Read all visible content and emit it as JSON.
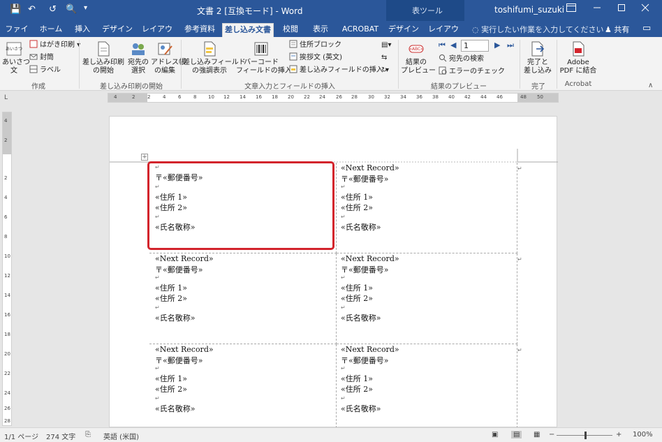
{
  "titlebar": {
    "doc_title": "文書 2 [互換モード] - Word",
    "context_tool": "表ツール",
    "user": "toshifumi_suzuki",
    "quick_access": {
      "save": "💾",
      "undo": "↶",
      "redo": "↺",
      "preview": "🔍",
      "customize": "▾"
    }
  },
  "tabs": [
    {
      "label": "ファイル"
    },
    {
      "label": "ホーム"
    },
    {
      "label": "挿入"
    },
    {
      "label": "デザイン"
    },
    {
      "label": "レイアウト"
    },
    {
      "label": "参考資料"
    },
    {
      "label": "差し込み文書"
    },
    {
      "label": "校閲"
    },
    {
      "label": "表示"
    },
    {
      "label": "ACROBAT"
    },
    {
      "label": "デザイン"
    },
    {
      "label": "レイアウト"
    }
  ],
  "tell_me": "実行したい作業を入力してください",
  "share": "共有",
  "ribbon": {
    "create": {
      "greeting_btn": "あいさつ\n文",
      "postcard": "はがき印刷",
      "envelope": "封筒",
      "labels": "ラベル",
      "group": "作成"
    },
    "start_merge": {
      "start_btn": "差し込み印刷\nの開始",
      "select_btn": "宛先の\n選択",
      "edit_btn": "アドレス帳\nの編集",
      "group": "差し込み印刷の開始"
    },
    "write_insert": {
      "highlight_btn": "差し込みフィールド\nの強調表示",
      "barcode_btn": "バーコード\nフィールドの挿入",
      "address_block": "住所ブロック",
      "greeting_line": "挨拶文 (英文)",
      "insert_field": "差し込みフィールドの挿入",
      "group": "文章入力とフィールドの挿入"
    },
    "preview": {
      "preview_btn": "結果の\nプレビュー",
      "record_value": "1",
      "find_recipient": "宛先の検索",
      "check_errors": "エラーのチェック",
      "group": "結果のプレビュー"
    },
    "finish": {
      "finish_btn": "完了と\n差し込み",
      "group": "完了"
    },
    "acrobat": {
      "pdf_btn": "Adobe\nPDF に結合",
      "group": "Acrobat"
    }
  },
  "ruler_numbers": [
    "4",
    "2",
    "2",
    "4",
    "6",
    "8",
    "10",
    "12",
    "14",
    "16",
    "18",
    "20",
    "22",
    "24",
    "26",
    "28",
    "30",
    "32",
    "34",
    "36",
    "38",
    "40",
    "42",
    "44",
    "46",
    "48",
    "50"
  ],
  "vruler_numbers": [
    "4",
    "2",
    "2",
    "4",
    "6",
    "8",
    "10",
    "12",
    "14",
    "16",
    "18",
    "20",
    "22",
    "24",
    "26",
    "28"
  ],
  "labels": {
    "next_record": "«Next Record»",
    "postal": "〒«郵便番号»",
    "address1": "«住所 1»",
    "address2": "«住所 2»",
    "name": "«氏名敬称»"
  },
  "statusbar": {
    "page": "1/1 ページ",
    "words": "274 文字",
    "language": "英語 (米国)",
    "zoom": "100%",
    "zoom_minus": "−",
    "zoom_plus": "+"
  }
}
